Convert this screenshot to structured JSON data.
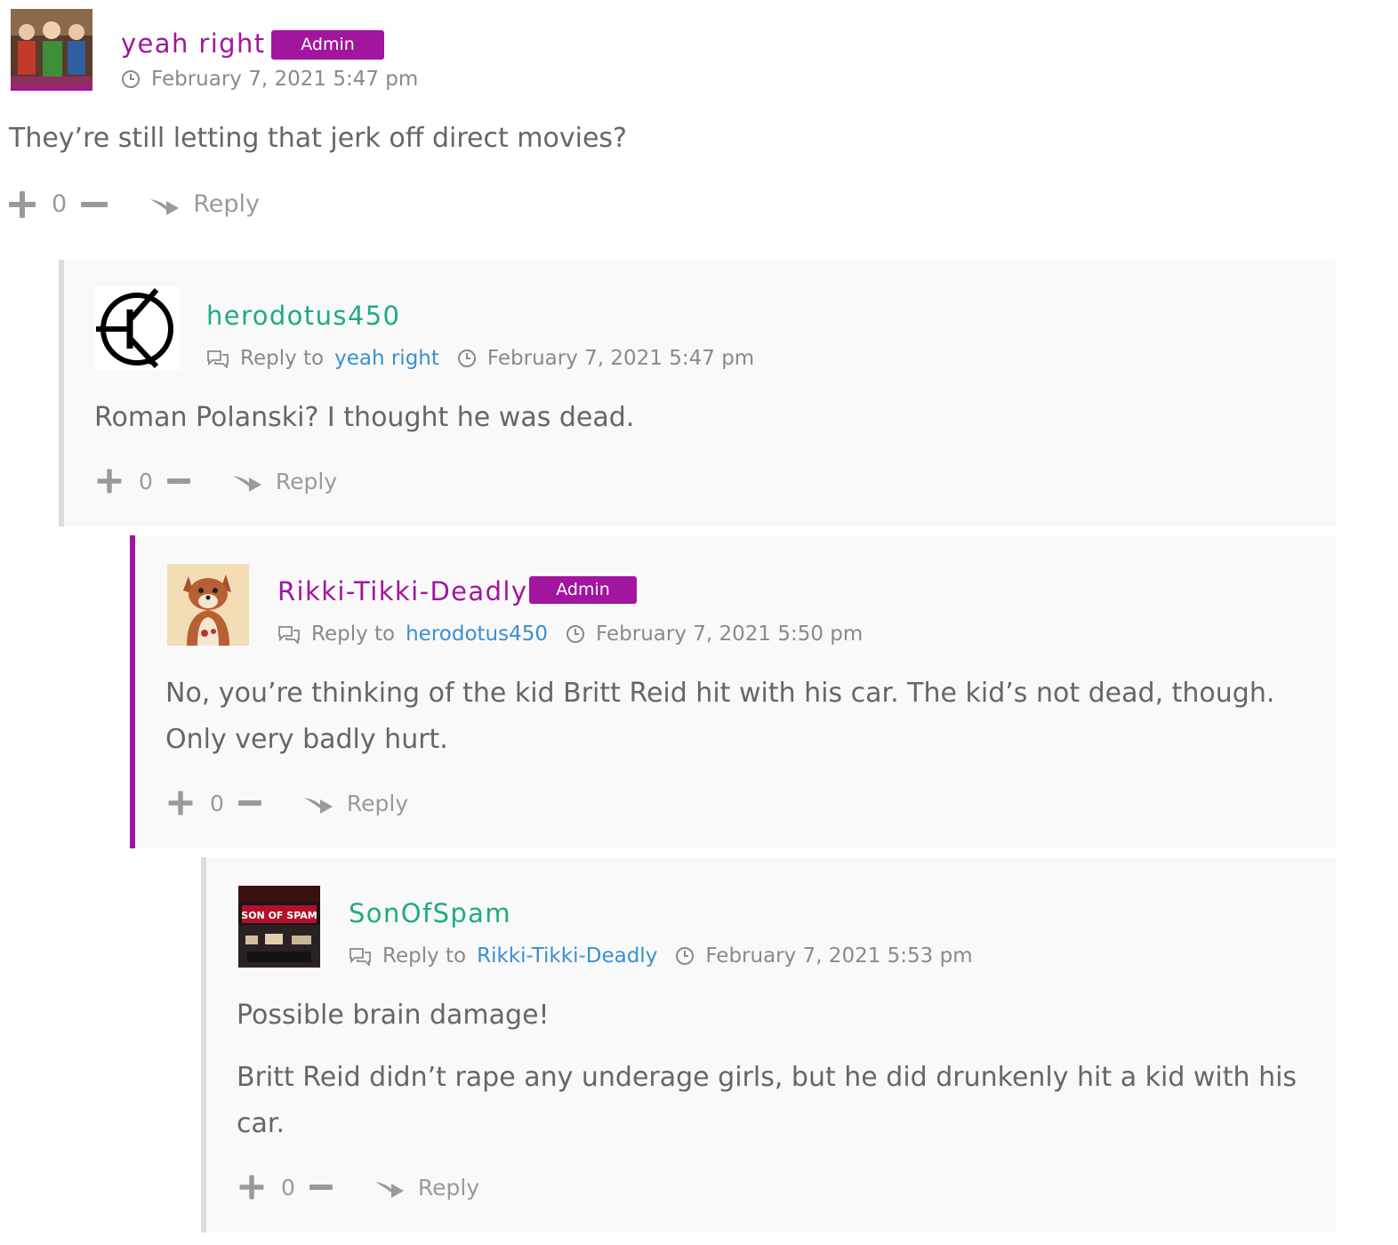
{
  "colors": {
    "admin_accent": "#a2159e",
    "member_name": "#1dab85",
    "link": "#3a8fd0",
    "text": "#666666",
    "meta": "#8a8a8a",
    "thread_bg": "#f9f9f9",
    "thread_border": "#dddddd"
  },
  "reply_to_label": "Reply to",
  "reply_label": "Reply",
  "comments": [
    {
      "author": "yeah right",
      "badge": "Admin",
      "timestamp": "February 7, 2021 5:47 pm",
      "paragraphs": [
        "They’re still letting that jerk off direct movies?"
      ],
      "votes": "0",
      "avatar_icon": "avatar-photo-icon"
    },
    {
      "author": "herodotus450",
      "reply_to": "yeah right",
      "timestamp": "February 7, 2021 5:47 pm",
      "paragraphs": [
        "Roman Polanski? I thought he was dead."
      ],
      "votes": "0",
      "avatar_icon": "transistor-symbol-icon"
    },
    {
      "author": "Rikki-Tikki-Deadly",
      "badge": "Admin",
      "reply_to": "herodotus450",
      "timestamp": "February 7, 2021 5:50 pm",
      "paragraphs": [
        "No, you’re thinking of the kid Britt Reid hit with his car. The kid’s not dead, though. Only very badly hurt."
      ],
      "votes": "0",
      "avatar_icon": "mongoose-cartoon-icon"
    },
    {
      "author": "SonOfSpam",
      "reply_to": "Rikki-Tikki-Deadly",
      "timestamp": "February 7, 2021 5:53 pm",
      "paragraphs": [
        "Possible brain damage!",
        "Britt Reid didn’t rape any underage girls, but he did drunkenly hit a kid with his car."
      ],
      "votes": "0",
      "avatar_icon": "son-of-spam-photo-icon",
      "avatar_text": "SON OF SPAM"
    }
  ]
}
